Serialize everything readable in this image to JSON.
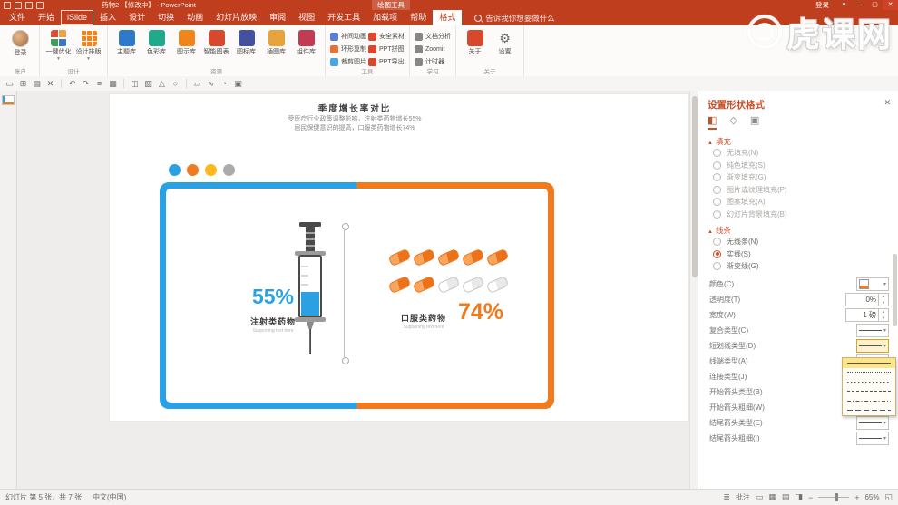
{
  "watermark": {
    "text": "虎课网"
  },
  "titlebar": {
    "title": "药物2 【修改中】 - PowerPoint",
    "context_tab_group": "绘图工具",
    "login": "登录"
  },
  "icons": {
    "close": "✕",
    "minimize": "—",
    "maximize": "▢",
    "dropdown": "▾",
    "up": "▲",
    "down": "▼",
    "section_caret": "▲",
    "gear": "⚙",
    "fill_tab": "◧",
    "effects_tab": "◇",
    "size_tab": "▣",
    "comments": "≣",
    "view_normal": "▭",
    "view_sorter": "▦",
    "view_reading": "▤",
    "view_slideshow": "◨",
    "fit": "◱",
    "zoom_out": "−",
    "zoom_in": "+"
  },
  "tabs": [
    {
      "label": "文件"
    },
    {
      "label": "开始"
    },
    {
      "label": "iSlide"
    },
    {
      "label": "插入"
    },
    {
      "label": "设计"
    },
    {
      "label": "切换"
    },
    {
      "label": "动画"
    },
    {
      "label": "幻灯片放映"
    },
    {
      "label": "审阅"
    },
    {
      "label": "视图"
    },
    {
      "label": "开发工具"
    },
    {
      "label": "加载项"
    },
    {
      "label": "帮助"
    },
    {
      "label": "格式"
    }
  ],
  "search_placeholder": "告诉我你想要做什么",
  "ribbon": {
    "account_label": "账户",
    "account_item": "登录",
    "design_label": "设计",
    "design_items": [
      "一键优化",
      "设计排版"
    ],
    "resources_label": "资源",
    "resources": [
      "主题库",
      "色彩库",
      "图示库",
      "智能图表",
      "图标库",
      "插图库",
      "组件库"
    ],
    "tools_label": "工具",
    "tools_col1": [
      "补间动画",
      "环形复制",
      "裁剪图片"
    ],
    "tools_col2": [
      "安全素材",
      "PPT拼图",
      "PPT导出"
    ],
    "learn_label": "学习",
    "learn_items": [
      "文档分析",
      "Zoomit",
      "计时器"
    ],
    "about_label": "关于",
    "about_items": [
      "关于",
      "设置"
    ]
  },
  "qat_icons": [
    "▭",
    "⊞",
    "▤",
    "✕",
    "↶",
    "↷",
    "≡",
    "▦",
    "◫",
    "▧",
    "△",
    "○",
    "▱",
    "∿",
    "◔",
    "▣"
  ],
  "slide": {
    "title": "季度增长率对比",
    "subtitle_line1": "受医疗行业政策调整影响，注射类药物增长55%",
    "subtitle_line2": "居民保健意识的提高，口服类药物增长74%",
    "left": {
      "percent": "55%",
      "label": "注射类药物",
      "support": "Supporting text here"
    },
    "right": {
      "percent": "74%",
      "label": "口服类药物",
      "support": "Supporting text here"
    },
    "colors": {
      "blue": "#2BA1E3",
      "orange": "#F07A1E",
      "amber": "#FFB81C",
      "gray": "#ABABAB"
    }
  },
  "panel": {
    "title": "设置形状格式",
    "fill_header": "填充",
    "fill_options": [
      "无填充(N)",
      "纯色填充(S)",
      "渐变填充(G)",
      "图片或纹理填充(P)",
      "图案填充(A)",
      "幻灯片背景填充(B)"
    ],
    "line_header": "线条",
    "line_options": [
      "无线条(N)",
      "实线(S)",
      "渐变线(G)"
    ],
    "props": [
      {
        "label": "颜色(C)"
      },
      {
        "label": "透明度(T)",
        "value": "0%"
      },
      {
        "label": "宽度(W)",
        "value": "1 磅"
      },
      {
        "label": "复合类型(C)"
      },
      {
        "label": "短划线类型(D)"
      },
      {
        "label": "线端类型(A)"
      },
      {
        "label": "连接类型(J)"
      },
      {
        "label": "开始箭头类型(B)"
      },
      {
        "label": "开始箭头粗细(W)"
      },
      {
        "label": "结尾箭头类型(E)"
      },
      {
        "label": "结尾箭头粗细(I)"
      }
    ]
  },
  "statusbar": {
    "slide_indicator": "幻灯片 第 5 张，共 7 张",
    "language": "中文(中国)",
    "comments_label": "批注",
    "zoom_percent": "65%"
  }
}
